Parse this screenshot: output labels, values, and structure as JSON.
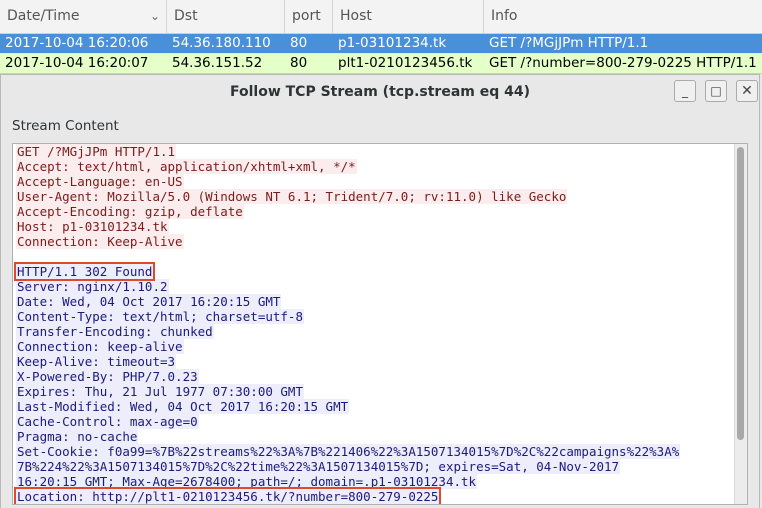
{
  "packet_list": {
    "columns": [
      "Date/Time",
      "Dst",
      "port",
      "Host",
      "Info"
    ],
    "rows": [
      {
        "datetime": "2017-10-04 16:20:06",
        "dst": "54.36.180.110",
        "port": "80",
        "host": "p1-03101234.tk",
        "info": "GET /?MGjJPm HTTP/1.1"
      },
      {
        "datetime": "2017-10-04 16:20:07",
        "dst": "54.36.151.52",
        "port": "80",
        "host": "plt1-0210123456.tk",
        "info": "GET /?number=800-279-0225 HTTP/1.1"
      }
    ]
  },
  "dialog": {
    "title": "Follow TCP Stream (tcp.stream eq 44)",
    "buttons": {
      "minimize": "_",
      "maximize": "□",
      "close": "✕"
    },
    "stream_label": "Stream Content"
  },
  "stream": {
    "request": [
      "GET /?MGjJPm HTTP/1.1",
      "Accept: text/html, application/xhtml+xml, */*",
      "Accept-Language: en-US",
      "User-Agent: Mozilla/5.0 (Windows NT 6.1; Trident/7.0; rv:11.0) like Gecko",
      "Accept-Encoding: gzip, deflate",
      "Host: p1-03101234.tk",
      "Connection: Keep-Alive"
    ],
    "response": [
      "HTTP/1.1 302 Found",
      "Server: nginx/1.10.2",
      "Date: Wed, 04 Oct 2017 16:20:15 GMT",
      "Content-Type: text/html; charset=utf-8",
      "Transfer-Encoding: chunked",
      "Connection: keep-alive",
      "Keep-Alive: timeout=3",
      "X-Powered-By: PHP/7.0.23",
      "Expires: Thu, 21 Jul 1977 07:30:00 GMT",
      "Last-Modified: Wed, 04 Oct 2017 16:20:15 GMT",
      "Cache-Control: max-age=0",
      "Pragma: no-cache",
      "Set-Cookie: f0a99=%7B%22streams%22%3A%7B%221406%22%3A1507134015%7D%2C%22campaigns%22%3A%",
      "7B%224%22%3A1507134015%7D%2C%22time%22%3A1507134015%7D; expires=Sat, 04-Nov-2017",
      "16:20:15 GMT; Max-Age=2678400; path=/; domain=.p1-03101234.tk",
      "Location: http://plt1-0210123456.tk/?number=800-279-0225"
    ]
  },
  "colors": {
    "request_bg": "#fbeded",
    "request_fg": "#7d1b1b",
    "response_bg": "#ededfb",
    "response_fg": "#1b1b7d",
    "selected_row": "#4a90d9",
    "http_row": "#e4ffc7",
    "highlight_box": "#e04a2a"
  },
  "icons": {
    "sort": "chevron-down-icon"
  }
}
